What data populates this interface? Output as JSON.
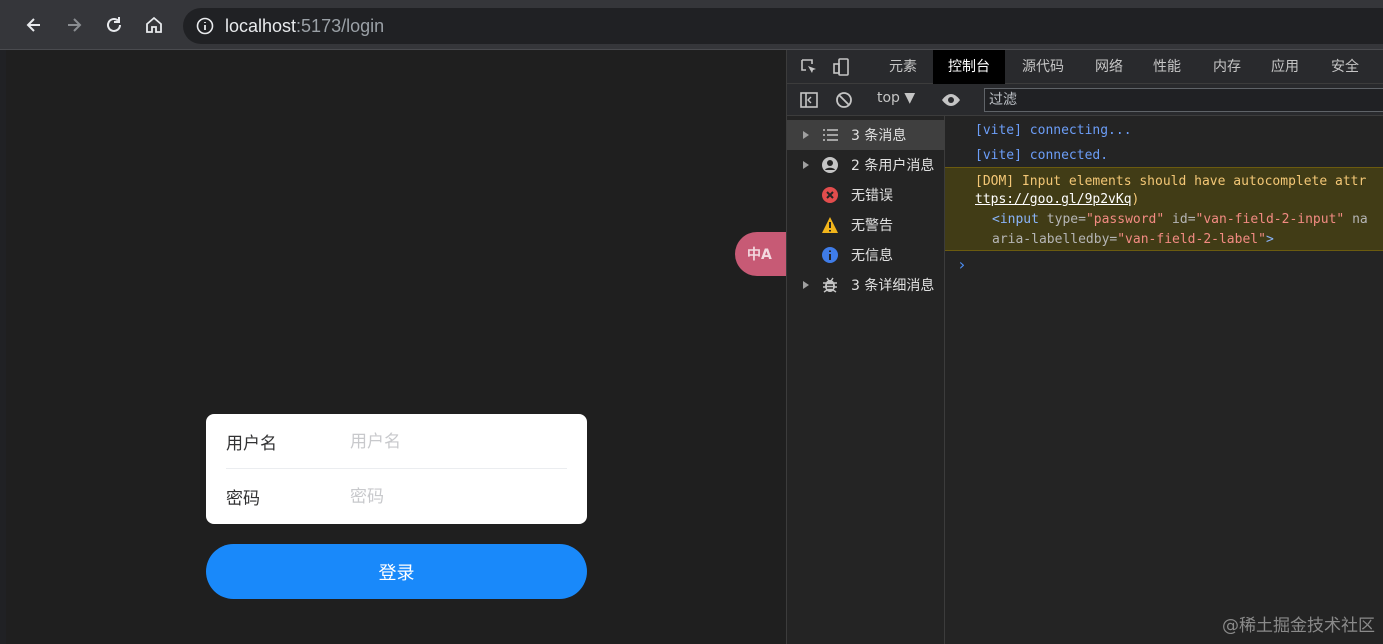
{
  "browser": {
    "url_host": "localhost",
    "url_rest": ":5173/login"
  },
  "page": {
    "username_label": "用户名",
    "username_placeholder": "用户名",
    "password_label": "密码",
    "password_placeholder": "密码",
    "login_label": "登录",
    "translate_badge": "中A"
  },
  "devtools": {
    "tabs": [
      "元素",
      "控制台",
      "源代码",
      "网络",
      "性能",
      "内存",
      "应用",
      "安全"
    ],
    "active_tab": "控制台",
    "context": "top",
    "filter_placeholder": "过滤",
    "sidebar": [
      {
        "label": "3 条消息",
        "icon": "list-icon"
      },
      {
        "label": "2 条用户消息",
        "icon": "user-icon"
      },
      {
        "label": "无错误",
        "icon": "error-icon"
      },
      {
        "label": "无警告",
        "icon": "warning-icon"
      },
      {
        "label": "无信息",
        "icon": "info-icon"
      },
      {
        "label": "3 条详细消息",
        "icon": "bug-icon"
      }
    ],
    "console": {
      "line1": "[vite] connecting...",
      "line2": "[vite] connected.",
      "warn_text": "[DOM] Input elements should have autocomplete attr",
      "warn_link": "ttps://goo.gl/9p2vKq",
      "warn_link_suffix": ")",
      "code_part1_tag": "<input ",
      "code_part1_attr1": "type=",
      "code_part1_val1": "\"password\"",
      "code_part1_attr2": " id=",
      "code_part1_val2": "\"van-field-2-input\"",
      "code_part1_attr3": " na",
      "code_part2_attr": "aria-labelledby=",
      "code_part2_val": "\"van-field-2-label\"",
      "code_part2_tag": ">",
      "prompt": "›"
    },
    "colors": {
      "accent": "#1989fa",
      "warning_bg": "#413c16",
      "link": "#6c9ef8"
    }
  },
  "watermark": "@稀土掘金技术社区"
}
